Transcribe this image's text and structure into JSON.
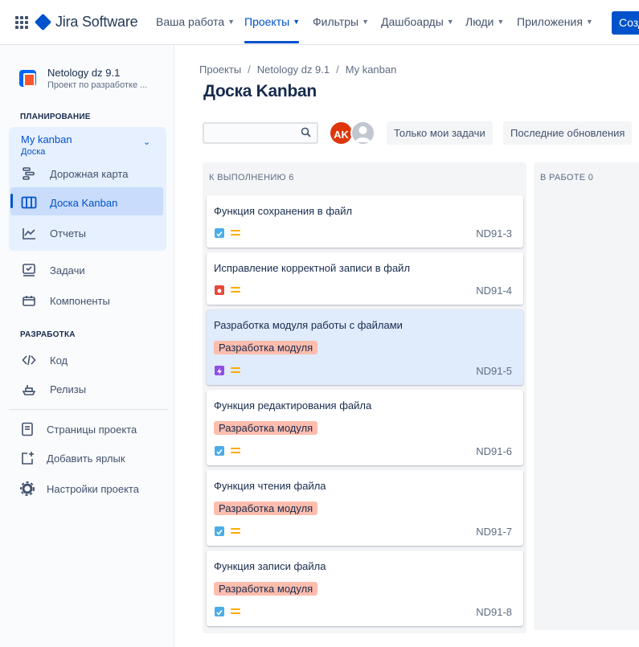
{
  "topnav": {
    "logo_text": "Jira Software",
    "items": [
      {
        "label": "Ваша работа"
      },
      {
        "label": "Проекты"
      },
      {
        "label": "Фильтры"
      },
      {
        "label": "Дашбоарды"
      },
      {
        "label": "Люди"
      },
      {
        "label": "Приложения"
      }
    ],
    "create_label": "Созд",
    "accent_color": "#0052cc"
  },
  "sidebar": {
    "project_name": "Netology dz 9.1",
    "project_sub": "Проект по разработке ...",
    "section_planning": "ПЛАНИРОВАНИЕ",
    "board_selector": {
      "name": "My kanban",
      "sub": "Доска"
    },
    "planning_items": [
      {
        "label": "Дорожная карта",
        "icon": "roadmap-icon"
      },
      {
        "label": "Доска Kanban",
        "icon": "board-icon"
      },
      {
        "label": "Отчеты",
        "icon": "reports-icon"
      }
    ],
    "other_items": [
      {
        "label": "Задачи",
        "icon": "issues-icon"
      },
      {
        "label": "Компоненты",
        "icon": "components-icon"
      }
    ],
    "section_dev": "РАЗРАБОТКА",
    "dev_items": [
      {
        "label": "Код",
        "icon": "code-icon"
      },
      {
        "label": "Релизы",
        "icon": "releases-icon"
      }
    ],
    "footer_items": [
      {
        "label": "Страницы проекта",
        "icon": "pages-icon"
      },
      {
        "label": "Добавить ярлык",
        "icon": "add-shortcut-icon"
      },
      {
        "label": "Настройки проекта",
        "icon": "settings-icon"
      }
    ]
  },
  "breadcrumbs": [
    "Проекты",
    "Netology dz 9.1",
    "My kanban"
  ],
  "page_title": "Доска Kanban",
  "toolbar": {
    "search_placeholder": "",
    "avatar_initials": "AK",
    "filters": [
      "Только мои задачи",
      "Последние обновления"
    ]
  },
  "columns": [
    {
      "title": "К ВЫПОЛНЕНИЮ 6"
    },
    {
      "title": "В РАБОТЕ 0"
    }
  ],
  "cards": [
    {
      "title": "Функция сохранения в файл",
      "label": "",
      "type": "task",
      "key": "ND91-3"
    },
    {
      "title": "Исправление корректной записи в файл",
      "label": "",
      "type": "bug",
      "key": "ND91-4"
    },
    {
      "title": "Разработка модуля работы с файлами",
      "label": "Разработка модуля",
      "type": "epic",
      "key": "ND91-5"
    },
    {
      "title": "Функция редактирования файла",
      "label": "Разработка модуля",
      "type": "task",
      "key": "ND91-6"
    },
    {
      "title": "Функция чтения файла",
      "label": "Разработка модуля",
      "type": "task",
      "key": "ND91-7"
    },
    {
      "title": "Функция записи файла",
      "label": "Разработка модуля",
      "type": "task",
      "key": "ND91-8"
    }
  ]
}
